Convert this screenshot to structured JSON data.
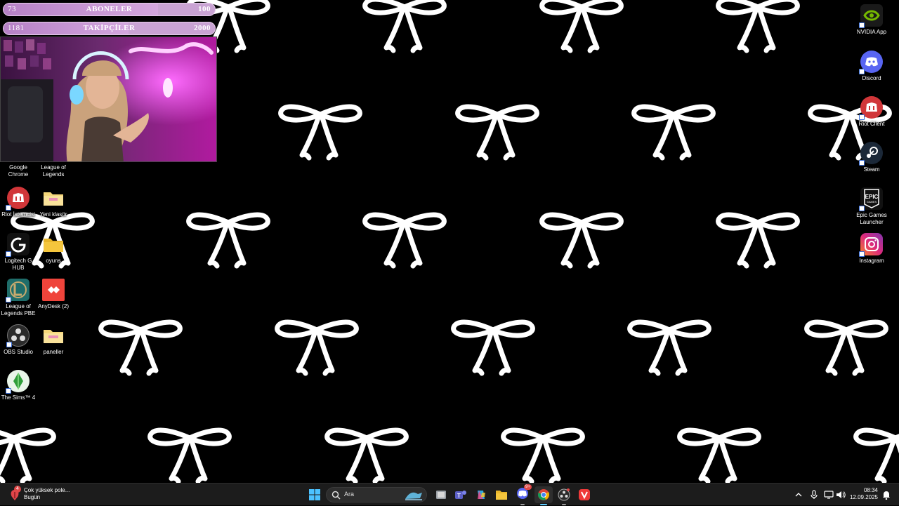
{
  "overlay": {
    "subs": {
      "current": "73",
      "title": "ABONELER",
      "target": "100",
      "progress": 0.73
    },
    "followers": {
      "current": "1181",
      "title": "TAKİPÇİLER",
      "target": "2000",
      "progress": 0.59
    }
  },
  "desktop_left": [
    {
      "label": "Google Chrome",
      "icon": "chrome-icon",
      "color": "#000000"
    },
    {
      "label": "League of Legends",
      "icon": "league-icon",
      "color": "#000000"
    },
    {
      "label": "Riot İstemcisi",
      "icon": "riot-icon",
      "color": "#d13639"
    },
    {
      "label": "Yeni klasör",
      "icon": "folder-icon",
      "color": "#f5d77a"
    },
    {
      "label": "Logitech G HUB",
      "icon": "logitech-icon",
      "color": "#111111"
    },
    {
      "label": "oyuns",
      "icon": "folder-icon",
      "color": "#f5c63d"
    },
    {
      "label": "League of Legends PBE",
      "icon": "league-pbe-icon",
      "color": "#1f6d6a"
    },
    {
      "label": "AnyDesk (2)",
      "icon": "anydesk-icon",
      "color": "#ef443b"
    },
    {
      "label": "OBS Studio",
      "icon": "obs-icon",
      "color": "#2b2b2b"
    },
    {
      "label": "paneller",
      "icon": "folder-icon",
      "color": "#f5d77a"
    },
    {
      "label": "The Sims™ 4",
      "icon": "sims-icon",
      "color": "#2f9e3a"
    }
  ],
  "desktop_right": [
    {
      "label": "NVIDIA App",
      "icon": "nvidia-icon",
      "color": "#111111"
    },
    {
      "label": "Discord",
      "icon": "discord-icon",
      "color": "#5865f2"
    },
    {
      "label": "Riot Client",
      "icon": "riot-icon",
      "color": "#d13639"
    },
    {
      "label": "Steam",
      "icon": "steam-icon",
      "color": "#1b2838"
    },
    {
      "label": "Epic Games Launcher",
      "icon": "epic-icon",
      "color": "#111111"
    },
    {
      "label": "Instagram",
      "icon": "instagram-icon",
      "color": "#d62976"
    }
  ],
  "taskbar": {
    "weather_title": "Çok yüksek pole...",
    "weather_sub": "Bugün",
    "weather_badge": "4",
    "search_placeholder": "Ara",
    "discord_badge": "9+",
    "time": "08:34",
    "date": "12.09.2025"
  }
}
